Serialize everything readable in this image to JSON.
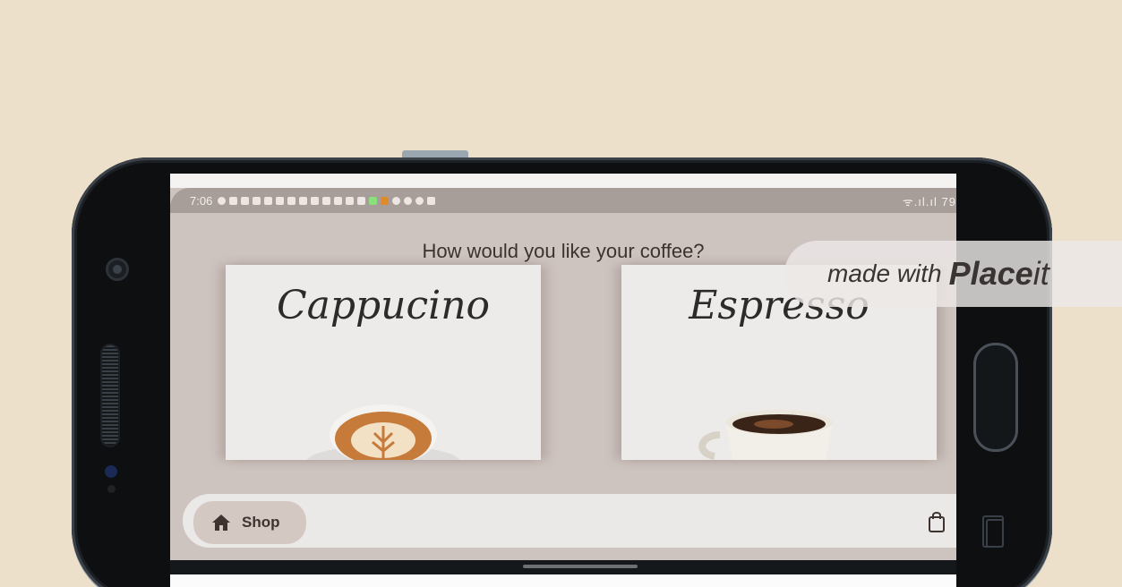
{
  "status_bar": {
    "time": "7:06",
    "right": "ᯤ.ıl.ıl 79"
  },
  "page": {
    "question": "How would you like your coffee?"
  },
  "products": [
    {
      "name": "Cappucino"
    },
    {
      "name": "Espresso"
    }
  ],
  "nav": {
    "shop_label": "Shop",
    "home_icon": "home-icon",
    "bag_icon": "shopping-bag-icon"
  },
  "watermark": {
    "prefix": "made with",
    "brand_bold": "Place",
    "brand_suffix": "it"
  },
  "colors": {
    "background": "#ede0cb",
    "screen": "#cec4bf",
    "accent": "#d4c8c3"
  }
}
